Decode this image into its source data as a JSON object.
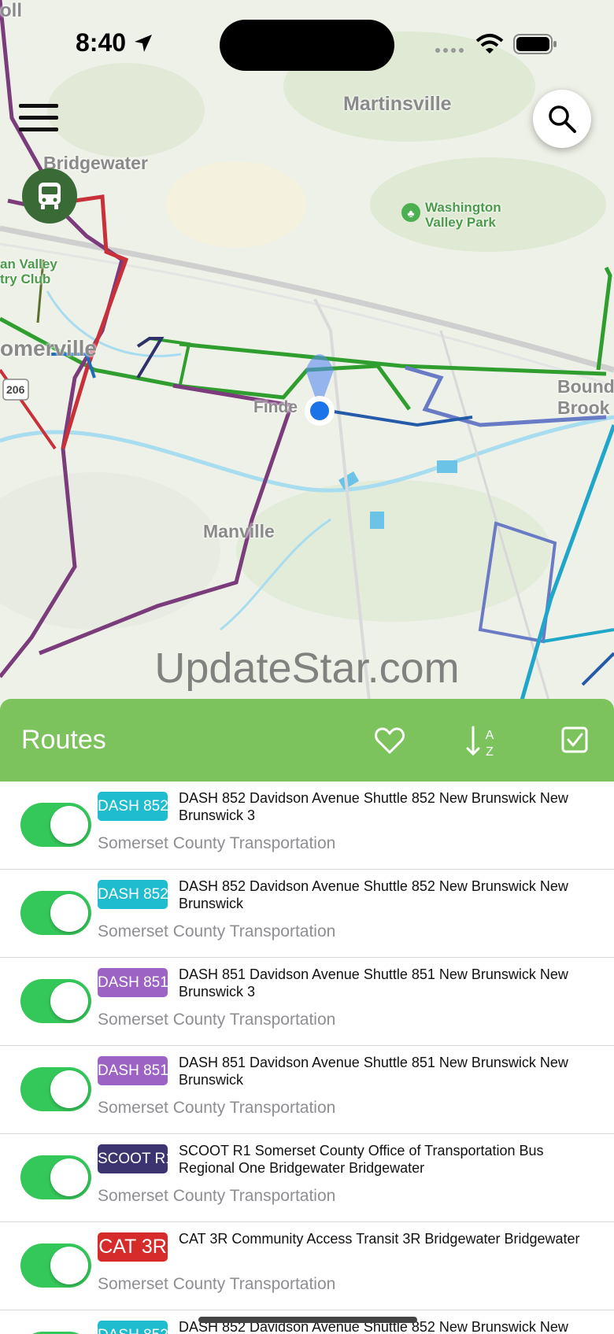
{
  "status_bar": {
    "time": "8:40"
  },
  "map": {
    "places": [
      "Martinsville",
      "Bridgewater",
      "Washington Valley Park",
      "an Valley\ntry Club",
      "omerville",
      "Finde",
      "Manville",
      "Bound\nBrook",
      "206",
      "oll"
    ],
    "watermark": "UpdateStar.com"
  },
  "panel": {
    "title": "Routes",
    "colors": {
      "header": "#7cc35e",
      "toggle_on": "#34c759"
    }
  },
  "routes": [
    {
      "badge": "DASH 852",
      "badge_color": "#1fbcd0",
      "name": "DASH 852 Davidson Avenue Shuttle 852 New Brunswick New Brunswick 3",
      "agency": "Somerset County Transportation",
      "enabled": true
    },
    {
      "badge": "DASH 852",
      "badge_color": "#1fbcd0",
      "name": "DASH 852 Davidson Avenue Shuttle 852 New Brunswick New Brunswick",
      "agency": "Somerset County Transportation",
      "enabled": true
    },
    {
      "badge": "DASH 851",
      "badge_color": "#9c63c4",
      "name": "DASH 851 Davidson Avenue Shuttle 851 New Brunswick New Brunswick 3",
      "agency": "Somerset County Transportation",
      "enabled": true
    },
    {
      "badge": "DASH 851",
      "badge_color": "#9c63c4",
      "name": "DASH 851 Davidson Avenue Shuttle 851 New Brunswick New Brunswick",
      "agency": "Somerset County Transportation",
      "enabled": true
    },
    {
      "badge": "SCOOT R1",
      "badge_color": "#3b3470",
      "name": "SCOOT R1 Somerset County Office of Transportation Bus Regional One Bridgewater Bridgewater",
      "agency": "Somerset County Transportation",
      "enabled": true
    },
    {
      "badge": "CAT 3R",
      "badge_color": "#d52b2b",
      "name": "CAT 3R Community Access Transit 3R Bridgewater Bridgewater",
      "agency": "Somerset County Transportation",
      "enabled": true
    },
    {
      "badge": "DASH 852",
      "badge_color": "#1fbcd0",
      "name": "DASH 852 Davidson Avenue Shuttle 852 New Brunswick New",
      "agency": "",
      "enabled": true
    }
  ]
}
